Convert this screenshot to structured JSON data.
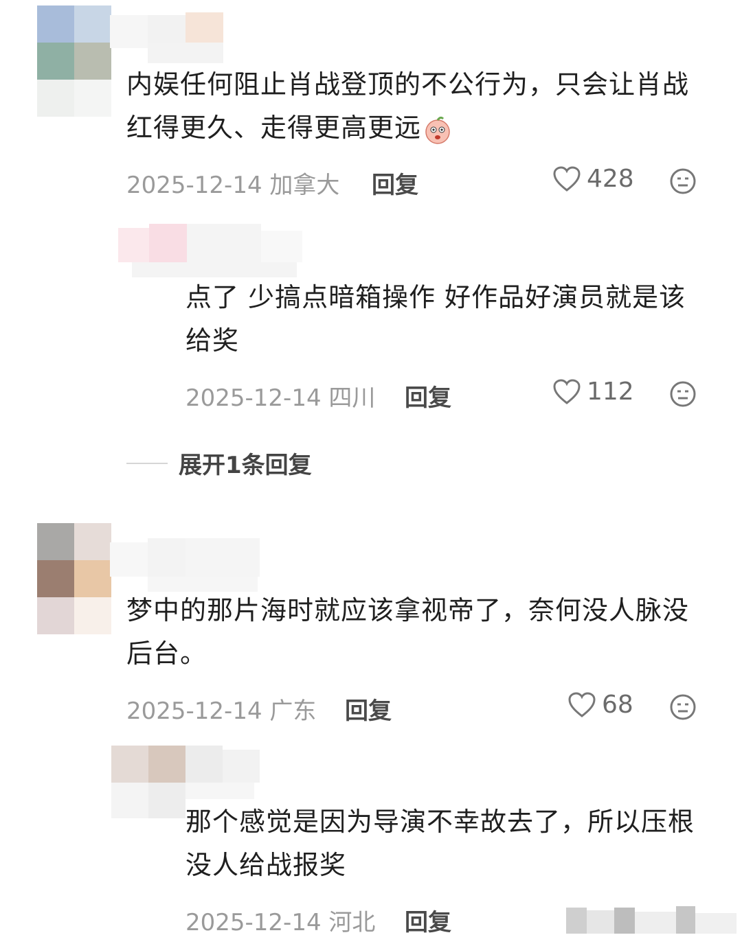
{
  "comments": [
    {
      "text": "内娱任何阻止肖战登顶的不公行为，只会让肖战红得更久、走得更高更远",
      "emoji": "peach-face-emoji",
      "date": "2025-12-14",
      "location": "加拿大",
      "reply_label": "回复",
      "likes": "428",
      "replies": [
        {
          "text": "点了 少搞点暗箱操作 好作品好演员就是该给奖",
          "date": "2025-12-14",
          "location": "四川",
          "reply_label": "回复",
          "likes": "112"
        }
      ],
      "expand_label": "展开1条回复"
    },
    {
      "text": "梦中的那片海时就应该拿视帝了，奈何没人脉没后台。",
      "date": "2025-12-14",
      "location": "广东",
      "reply_label": "回复",
      "likes": "68",
      "replies": [
        {
          "text": "那个感觉是因为导演不幸故去了，所以压根没人给战报奖",
          "date": "2025-12-14",
          "location": "河北",
          "reply_label": "回复"
        }
      ]
    }
  ],
  "colors": {
    "heart_stroke": "#777777",
    "meta_gray": "#9a9a9a"
  }
}
